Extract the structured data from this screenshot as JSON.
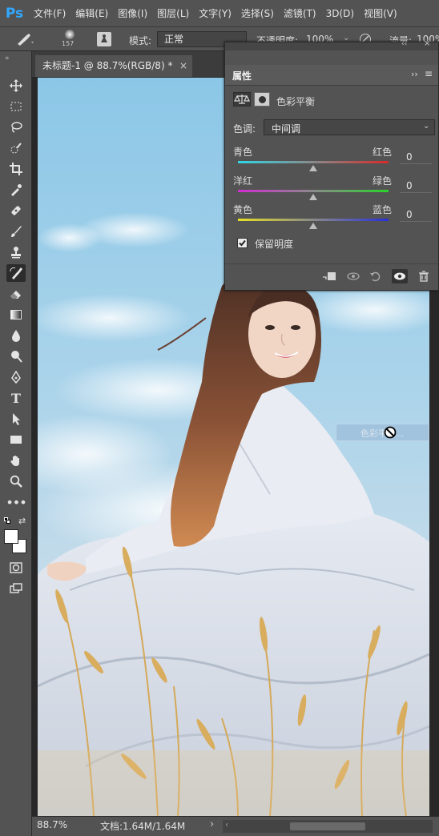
{
  "app": {
    "logo": "Ps"
  },
  "menu": [
    "文件(F)",
    "编辑(E)",
    "图像(I)",
    "图层(L)",
    "文字(Y)",
    "选择(S)",
    "滤镜(T)",
    "3D(D)",
    "视图(V)"
  ],
  "options": {
    "brush_size": "157",
    "mode_label": "模式:",
    "mode_value": "正常",
    "opacity_label": "不透明度:",
    "opacity_value": "100%",
    "flow_label": "流量:",
    "flow_value": "100%"
  },
  "document_tab": {
    "title": "未标题-1 @ 88.7%(RGB/8) *",
    "close": "×"
  },
  "collapsed_panel_arrows": "»",
  "panel": {
    "title": "属性",
    "collapse": "‹‹",
    "menu_icon": "≡",
    "close": "×",
    "adjustment_name": "色彩平衡",
    "tone_label": "色调:",
    "tone_value": "中间调",
    "sliders": [
      {
        "left": "青色",
        "right": "红色",
        "value": "0",
        "position": 0.5
      },
      {
        "left": "洋红",
        "right": "绿色",
        "value": "0",
        "position": 0.5
      },
      {
        "left": "黄色",
        "right": "蓝色",
        "value": "0",
        "position": 0.5
      }
    ],
    "preserve_label": "保留明度",
    "preserve_checked": true
  },
  "drag_tooltip": {
    "text": "色彩平衡..."
  },
  "status": {
    "zoom": "88.7%",
    "doc_info": "文档:1.64M/1.64M",
    "arrow": "›"
  },
  "colors": {
    "ps_blue": "#31a8ff",
    "panel_bg": "#535353",
    "workspace": "#282828",
    "sky_top": "#8dc7e8",
    "cyan_red_track": [
      "#2fd6e6",
      "#d62a2a"
    ],
    "magenta_green_track": [
      "#d22bd2",
      "#2ad22a"
    ],
    "yellow_blue_track": [
      "#e6df24",
      "#2830d8"
    ]
  },
  "icons": [
    "move-icon",
    "marquee-icon",
    "lasso-icon",
    "quick-select-icon",
    "crop-icon",
    "eyedropper-icon",
    "healing-icon",
    "brush-icon",
    "stamp-icon",
    "history-brush-icon",
    "eraser-icon",
    "gradient-icon",
    "blur-icon",
    "dodge-icon",
    "pen-icon",
    "type-icon",
    "path-select-icon",
    "rectangle-icon",
    "hand-icon",
    "zoom-icon",
    "more-icon"
  ]
}
